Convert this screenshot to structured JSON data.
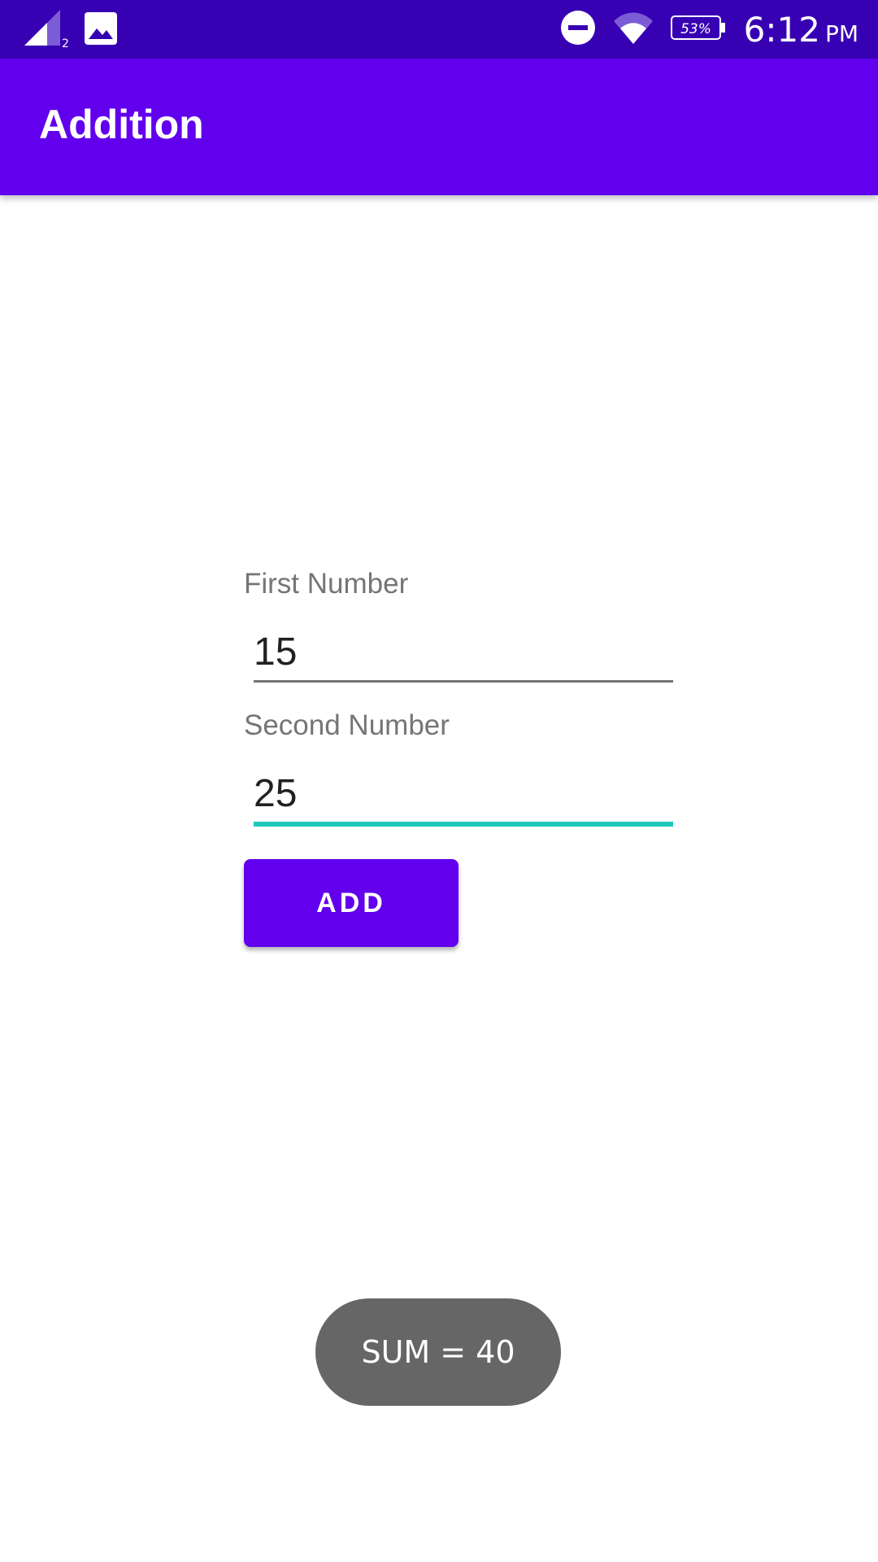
{
  "status_bar": {
    "icons": [
      "signal-icon",
      "image-icon",
      "dnd-icon",
      "wifi-icon",
      "battery-icon"
    ],
    "signal_sim": "2",
    "battery_percent": "53%",
    "time": "6:12",
    "ampm": "PM"
  },
  "app_bar": {
    "title": "Addition"
  },
  "form": {
    "first_label": "First Number",
    "first_value": "15",
    "second_label": "Second Number",
    "second_value": "25",
    "add_label": "ADD"
  },
  "toast": {
    "text": "SUM = 40"
  },
  "colors": {
    "status_bar": "#3700b3",
    "primary": "#6200ee",
    "accent": "#1ec8b8",
    "underline": "#757575",
    "toast_bg": "#666666"
  }
}
